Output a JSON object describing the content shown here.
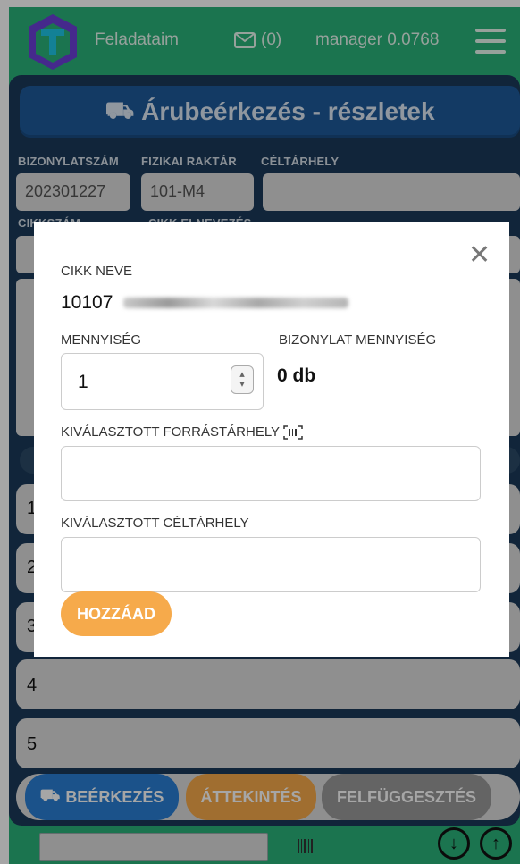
{
  "header": {
    "tasks_label": "Feladataim",
    "mail_count": "(0)",
    "user_label": "manager 0.0768"
  },
  "page": {
    "title": "Árubeérkezés - részletek"
  },
  "form": {
    "doc_number_label": "BIZONYLATSZÁM",
    "doc_number_value": "202301227",
    "warehouse_label": "FIZIKAI RAKTÁR",
    "warehouse_value": "101-M4",
    "target_location_label": "CÉLTÁRHELY",
    "target_location_value": "",
    "item_number_label": "CIKKSZÁM",
    "item_name_label": "CIKK ELNEVEZÉS"
  },
  "rows": [
    "1",
    "2",
    "3",
    "4",
    "5"
  ],
  "bottom_buttons": {
    "receive": "BEÉRKEZÉS",
    "review": "ÁTTEKINTÉS",
    "suspend": "FELFÜGGESZTÉS"
  },
  "modal": {
    "item_name_label": "CIKK NEVE",
    "item_name_value": "10107",
    "quantity_label": "MENNYISÉG",
    "quantity_value": "1",
    "doc_quantity_label": "BIZONYLAT MENNYISÉG",
    "doc_quantity_value": "0 db",
    "source_location_label": "KIVÁLASZTOTT FORRÁSTÁRHELY",
    "target_location_label": "KIVÁLASZTOTT CÉLTÁRHELY",
    "add_button": "HOZZÁAD"
  },
  "colors": {
    "brand_green": "#2ab37a",
    "panel_navy": "#1b3a59",
    "title_blue": "#1e5a9a",
    "accent_orange": "#f6aa4b",
    "button_blue": "#2a7fd4"
  }
}
